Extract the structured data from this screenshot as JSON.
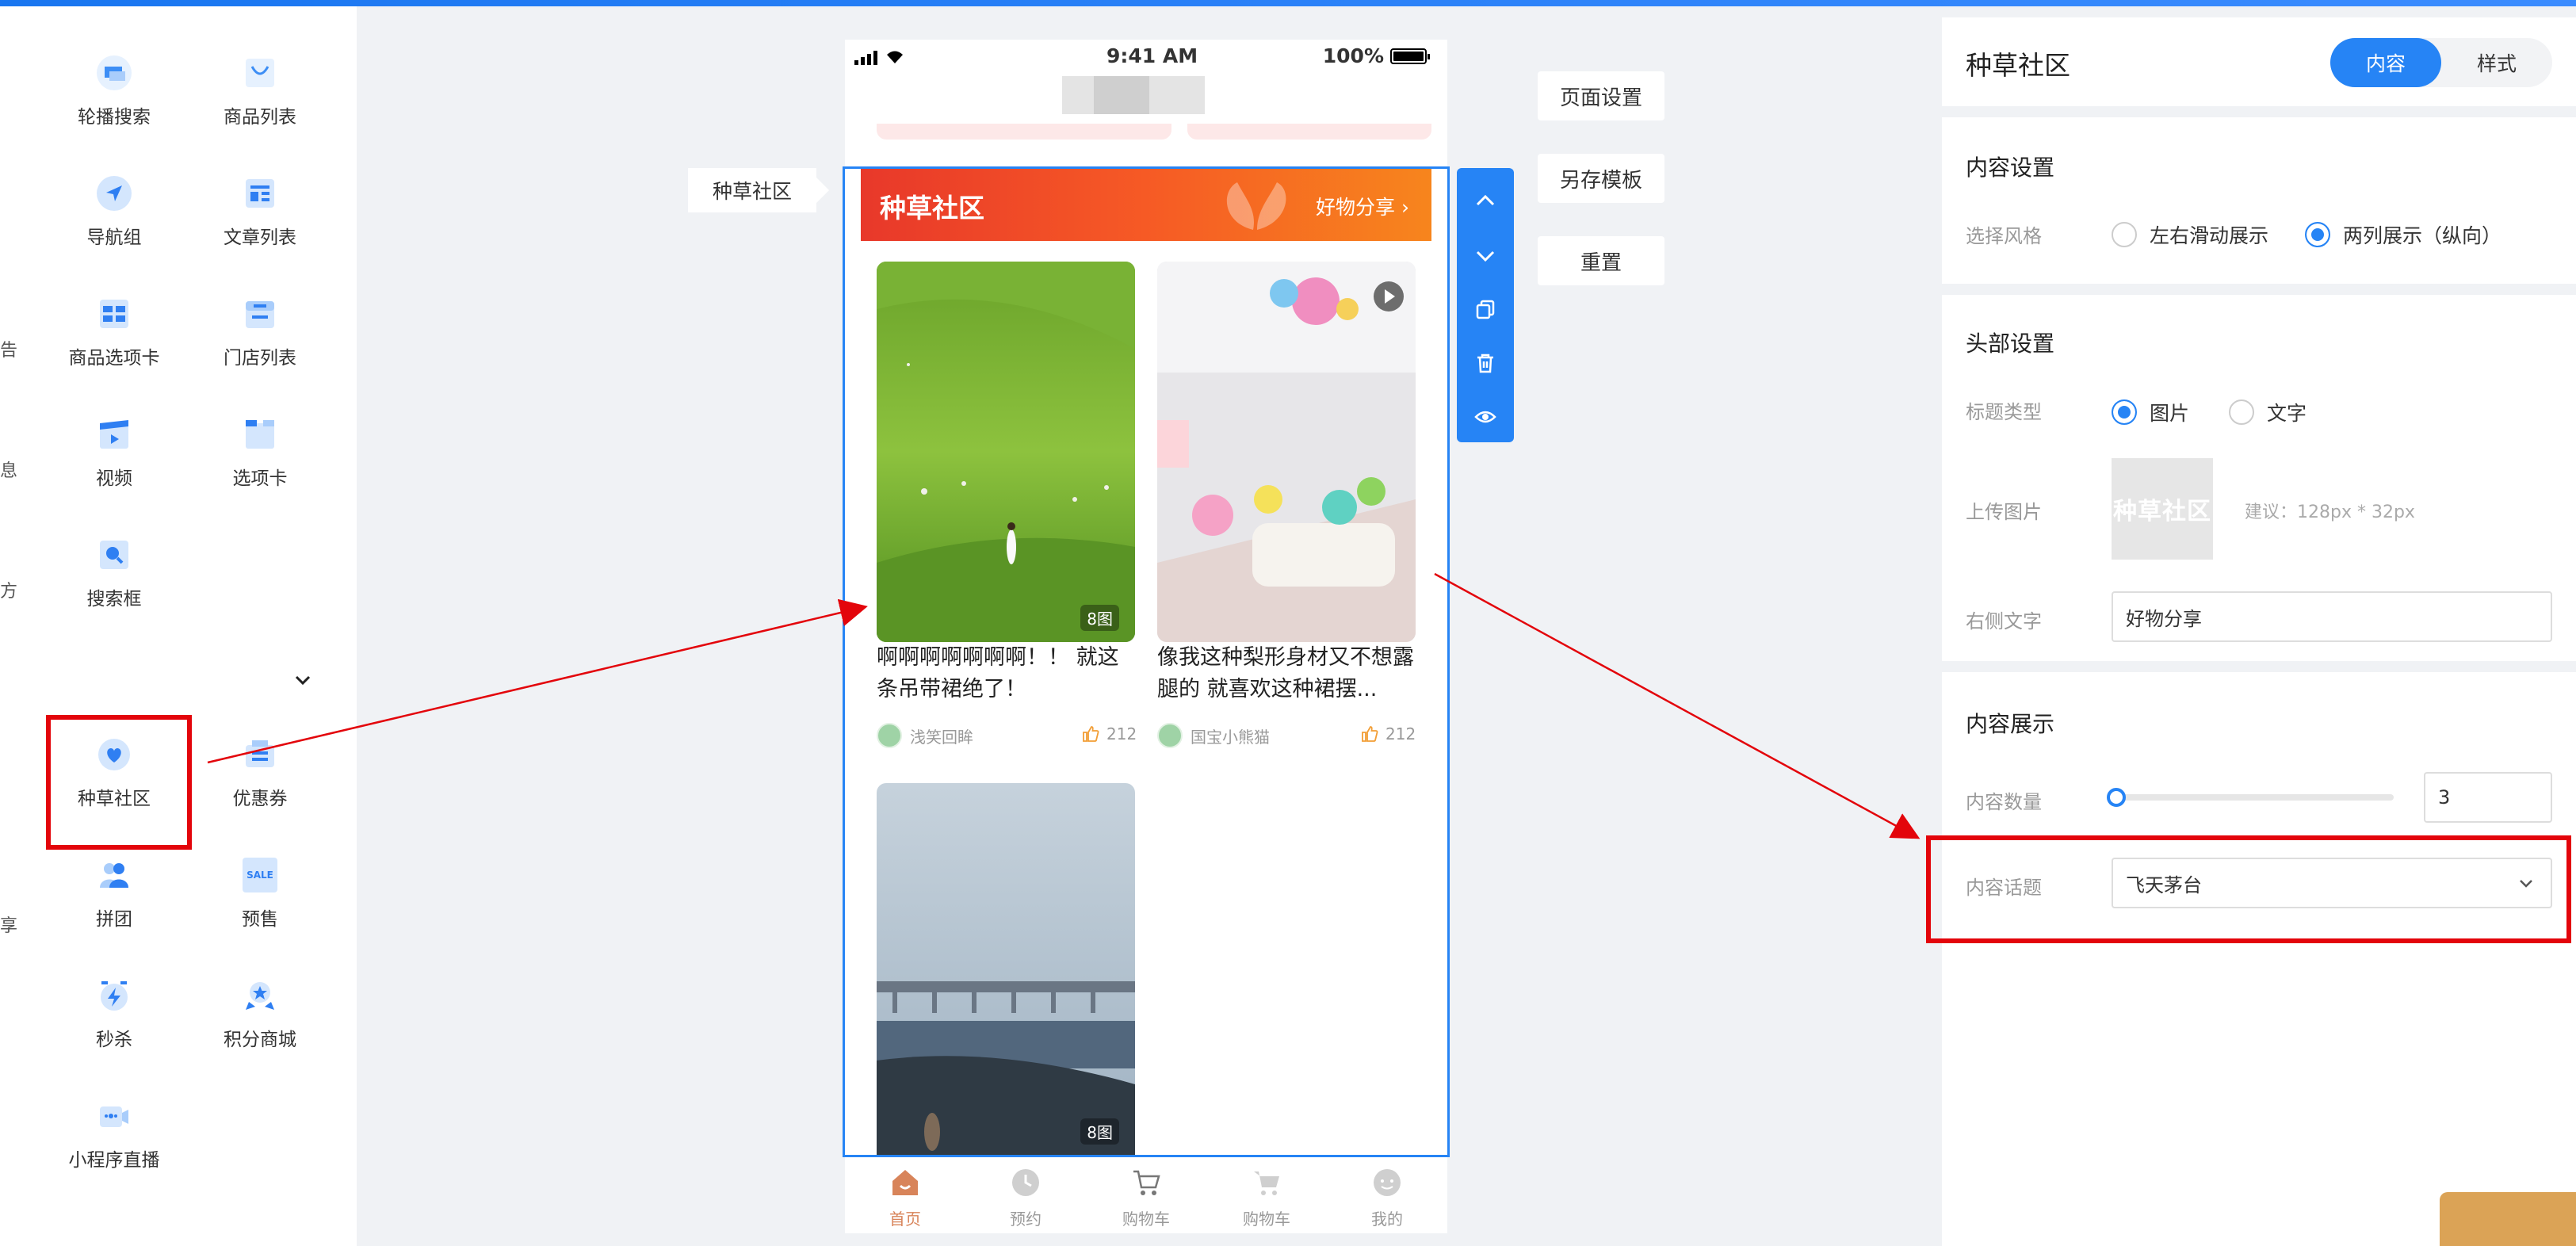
{
  "left_panel": {
    "items": [
      {
        "label": "轮播搜索",
        "icon": "carousel-search-icon"
      },
      {
        "label": "商品列表",
        "icon": "product-list-icon"
      },
      {
        "label": "导航组",
        "icon": "navigation-icon"
      },
      {
        "label": "文章列表",
        "icon": "article-list-icon"
      },
      {
        "label": "商品选项卡",
        "icon": "product-tab-icon"
      },
      {
        "label": "门店列表",
        "icon": "store-list-icon"
      },
      {
        "label": "视频",
        "icon": "video-icon"
      },
      {
        "label": "选项卡",
        "icon": "tab-icon"
      },
      {
        "label": "搜索框",
        "icon": "search-box-icon"
      },
      {
        "label": "种草社区",
        "icon": "heart-icon"
      },
      {
        "label": "优惠券",
        "icon": "coupon-icon"
      },
      {
        "label": "拼团",
        "icon": "group-buy-icon"
      },
      {
        "label": "预售",
        "icon": "sale-icon"
      },
      {
        "label": "秒杀",
        "icon": "flash-sale-icon"
      },
      {
        "label": "积分商城",
        "icon": "points-mall-icon"
      },
      {
        "label": "小程序直播",
        "icon": "live-icon"
      }
    ],
    "cut_labels": [
      "告",
      "息",
      "方",
      "享"
    ],
    "sale_text": "SALE"
  },
  "phone": {
    "status": {
      "time": "9:41 AM",
      "battery": "100%"
    },
    "selected_tag": "种草社区",
    "banner": {
      "title": "种草社区",
      "right_text": "好物分享 ›"
    },
    "cards": [
      {
        "title": "啊啊啊啊啊啊啊！！ 就这条吊带裙绝了！",
        "badge": "8图",
        "author": "浅笑回眸",
        "likes": "212"
      },
      {
        "title": "像我这种梨形身材又不想露腿的 就喜欢这种裙摆...",
        "author": "国宝小熊猫",
        "likes": "212"
      },
      {
        "badge": "8图"
      }
    ],
    "tabs": [
      {
        "label": "首页",
        "active": true
      },
      {
        "label": "预约"
      },
      {
        "label": "购物车"
      },
      {
        "label": "购物车"
      },
      {
        "label": "我的"
      }
    ]
  },
  "canvas_buttons": {
    "page_settings": "页面设置",
    "save_template": "另存模板",
    "reset": "重置"
  },
  "right_panel": {
    "title": "种草社区",
    "seg_content": "内容",
    "seg_style": "样式",
    "content_settings": {
      "heading": "内容设置",
      "style_label": "选择风格",
      "opt_slide": "左右滑动展示",
      "opt_two_col": "两列展示（纵向）"
    },
    "header_settings": {
      "heading": "头部设置",
      "title_type_label": "标题类型",
      "opt_image": "图片",
      "opt_text": "文字",
      "upload_label": "上传图片",
      "upload_preview_text": "种草社区",
      "upload_hint": "建议：128px * 32px",
      "right_text_label": "右侧文字",
      "right_text_value": "好物分享"
    },
    "content_display": {
      "heading": "内容展示",
      "count_label": "内容数量",
      "count_value": "3",
      "count_fraction": 0.0,
      "topic_label": "内容话题",
      "topic_value": "飞天茅台"
    }
  },
  "colors": {
    "accent": "#2684f5",
    "highlight_red": "#e3050b",
    "banner_orange": "#f65a25"
  }
}
